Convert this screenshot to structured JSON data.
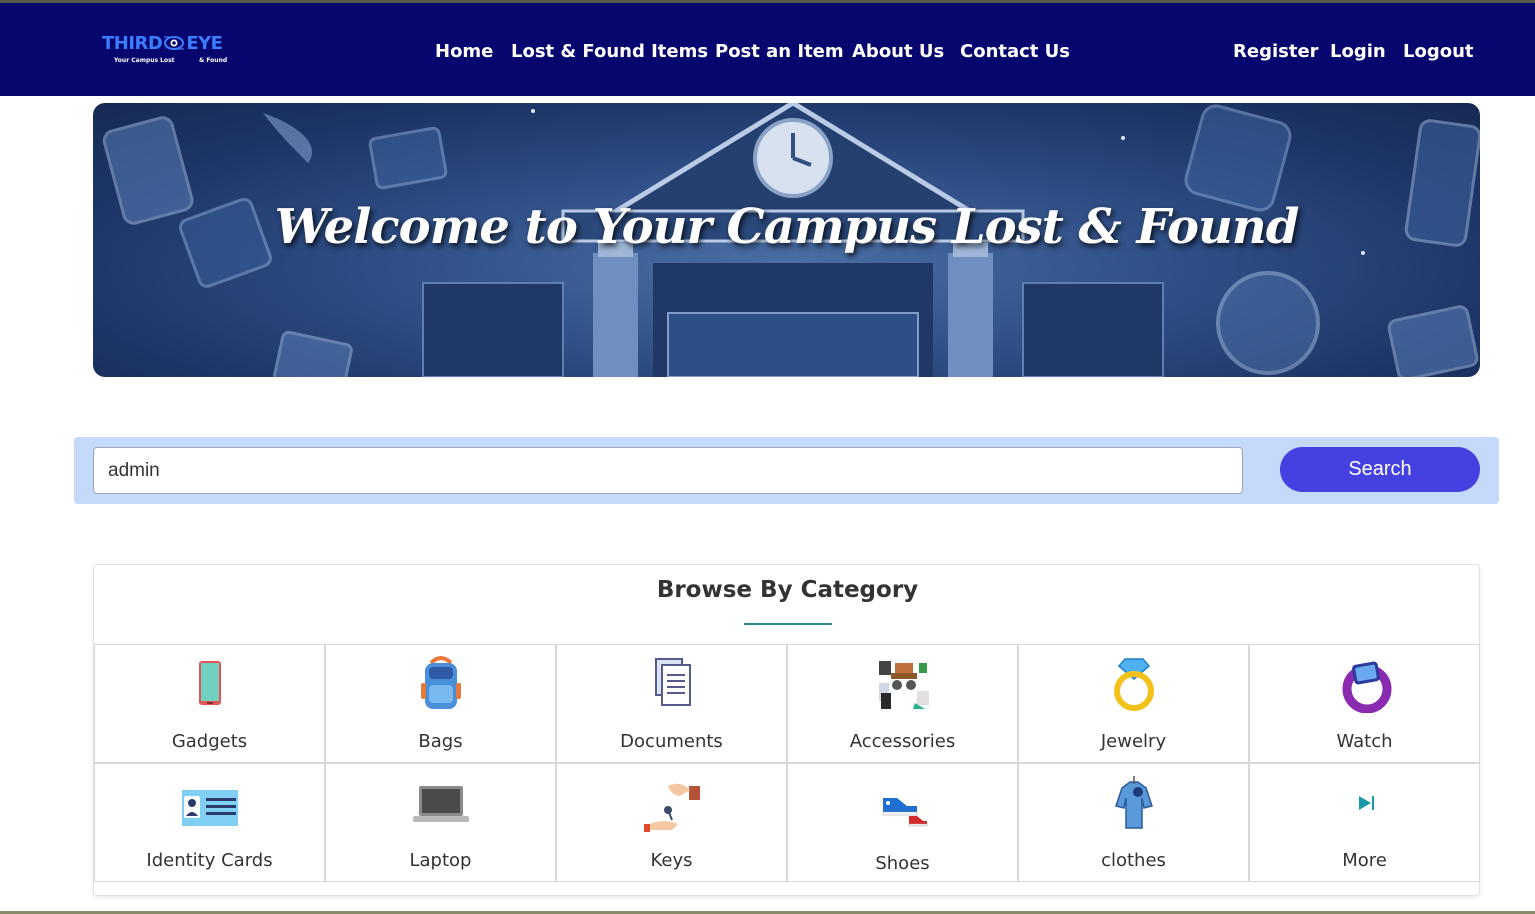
{
  "brand": {
    "logo_text_left": "THIRD",
    "logo_text_right": "EYE",
    "tagline_left": "Your Campus Lost",
    "tagline_right": "& Found",
    "nav_color": "#06066e"
  },
  "nav": {
    "home": "Home",
    "lost_found": "Lost & Found Items",
    "post": "Post an Item",
    "about": "About Us",
    "contact": "Contact Us",
    "register": "Register",
    "login": "Login",
    "logout": "Logout"
  },
  "hero": {
    "title": "Welcome to Your Campus Lost & Found"
  },
  "search": {
    "value": "admin",
    "button_label": "Search",
    "button_color": "#4540e0"
  },
  "categories": {
    "title": "Browse By Category",
    "items": [
      {
        "label": "Gadgets",
        "icon": "phone-icon"
      },
      {
        "label": "Bags",
        "icon": "backpack-icon"
      },
      {
        "label": "Documents",
        "icon": "document-icon"
      },
      {
        "label": "Accessories",
        "icon": "accessories-icon"
      },
      {
        "label": "Jewelry",
        "icon": "ring-icon"
      },
      {
        "label": "Watch",
        "icon": "smartwatch-icon"
      },
      {
        "label": "Identity Cards",
        "icon": "id-card-icon"
      },
      {
        "label": "Laptop",
        "icon": "laptop-icon"
      },
      {
        "label": "Keys",
        "icon": "keys-icon"
      },
      {
        "label": "Shoes",
        "icon": "sneakers-icon"
      },
      {
        "label": "clothes",
        "icon": "shirt-icon"
      },
      {
        "label": "More",
        "icon": "play-next-icon"
      }
    ]
  }
}
